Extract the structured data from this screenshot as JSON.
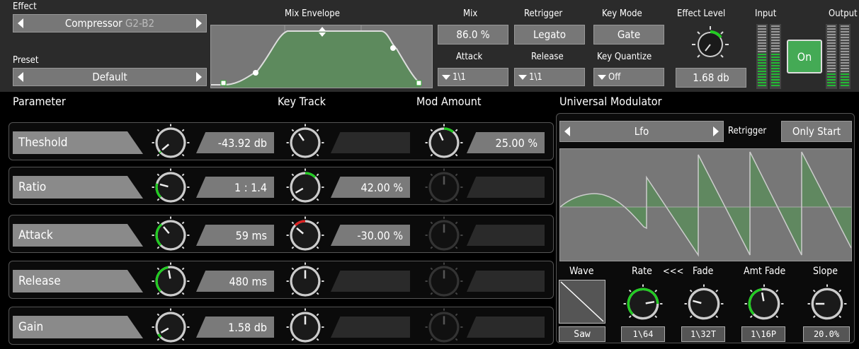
{
  "top": {
    "effect_label": "Effect",
    "effect_name": "Compressor",
    "effect_range": "G2-B2",
    "preset_label": "Preset",
    "preset_name": "Default",
    "mix_envelope_label": "Mix Envelope",
    "mix_label": "Mix",
    "mix_value": "86.0 %",
    "retrigger_label": "Retrigger",
    "retrigger_value": "Legato",
    "key_mode_label": "Key Mode",
    "key_mode_value": "Gate",
    "attack_label": "Attack",
    "attack_value": "1\\1",
    "release_label": "Release",
    "release_value": "1\\1",
    "key_quantize_label": "Key Quantize",
    "key_quantize_value": "Off",
    "effect_level_label": "Effect Level",
    "effect_level_value": "1.68 db",
    "input_label": "Input",
    "output_label": "Output",
    "on_label": "On"
  },
  "headers": {
    "parameter": "Parameter",
    "key_track": "Key Track",
    "mod_amount": "Mod Amount",
    "universal_modulator": "Universal Modulator"
  },
  "params": [
    {
      "name": "Theshold",
      "value": "-43.92 db",
      "keytrack": "",
      "mod": "25.00 %"
    },
    {
      "name": "Ratio",
      "value": "1 : 1.4",
      "keytrack": "42.00 %",
      "mod": ""
    },
    {
      "name": "Attack",
      "value": "59 ms",
      "keytrack": "-30.00 %",
      "mod": ""
    },
    {
      "name": "Release",
      "value": "480 ms",
      "keytrack": "",
      "mod": ""
    },
    {
      "name": "Gain",
      "value": "1.58 db",
      "keytrack": "",
      "mod": ""
    }
  ],
  "modulator": {
    "source": "Lfo",
    "retrigger_label": "Retrigger",
    "retrigger_value": "Only Start",
    "wave_label": "Wave",
    "wave_value": "Saw",
    "rate_label": "Rate",
    "rate_arrows": "<<<",
    "fade_label": "Fade",
    "amt_fade_label": "Amt Fade",
    "slope_label": "Slope",
    "rate_value": "1\\64",
    "fade_value": "1\\32T",
    "amt_fade_value": "1\\16P",
    "slope_value": "20.0%"
  },
  "colors": {
    "green": "#22cc22",
    "red": "#dd2222",
    "envelope_fill": "#5d8a5d",
    "on_button": "#44aa55"
  }
}
